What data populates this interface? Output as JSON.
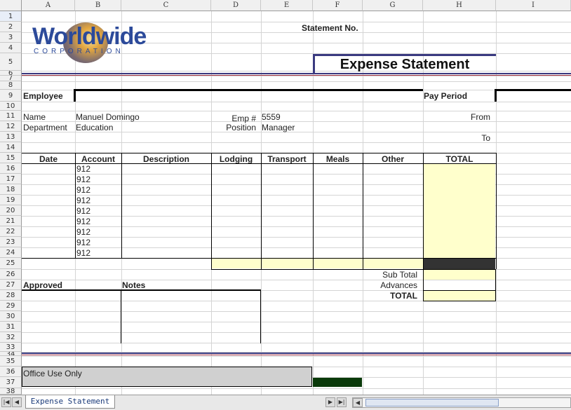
{
  "columns": [
    "A",
    "B",
    "C",
    "D",
    "E",
    "F",
    "G",
    "H",
    "I"
  ],
  "rows": [
    "1",
    "2",
    "3",
    "4",
    "5",
    "6",
    "7",
    "8",
    "9",
    "10",
    "11",
    "12",
    "13",
    "14",
    "15",
    "16",
    "17",
    "18",
    "19",
    "20",
    "21",
    "22",
    "23",
    "24",
    "25",
    "26",
    "27",
    "28",
    "29",
    "30",
    "31",
    "32",
    "33",
    "34",
    "35",
    "36",
    "37",
    "38"
  ],
  "logo": {
    "line1": "Worldwide",
    "line2": "CORPORATION"
  },
  "header": {
    "statement_no_label": "Statement No.",
    "title": "Expense Statement"
  },
  "employee": {
    "section_label": "Employee",
    "pay_period_label": "Pay Period",
    "name_label": "Name",
    "name_value": "Manuel Domingo",
    "department_label": "Department",
    "department_value": "Education",
    "emp_label": "Emp #",
    "emp_value": "5559",
    "position_label": "Position",
    "position_value": "Manager",
    "from_label": "From",
    "to_label": "To"
  },
  "table": {
    "headers": [
      "Date",
      "Account",
      "Description",
      "Lodging",
      "Transport",
      "Meals",
      "Other",
      "TOTAL"
    ],
    "account_values": [
      "912",
      "912",
      "912",
      "912",
      "912",
      "912",
      "912",
      "912",
      "912"
    ]
  },
  "summary": {
    "subtotal_label": "Sub Total",
    "advances_label": "Advances",
    "total_label": "TOTAL"
  },
  "footer": {
    "approved_label": "Approved",
    "notes_label": "Notes",
    "office_use_label": "Office Use Only"
  },
  "sheet_tab": {
    "label": "Expense Statement"
  },
  "colors": {
    "accent_line": "#3a3a80",
    "accent_red": "#a03040",
    "total_fill": "#ffffcc",
    "dark_cell": "#333333",
    "green_cell": "#0a3a0a"
  }
}
